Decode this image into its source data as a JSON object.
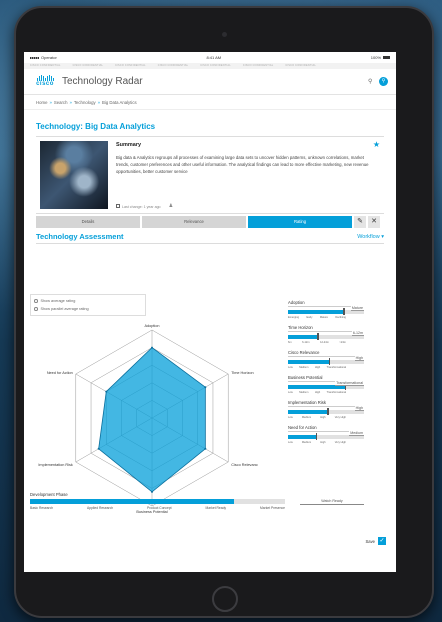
{
  "status": {
    "carrier": "Operator",
    "time": "8:41 AM",
    "battery": "100%"
  },
  "browser_tabs": [
    "CISCO CONFIDENTIAL",
    "CISCO CONFIDENTIAL",
    "CISCO CONFIDENTIAL",
    "CISCO CONFIDENTIAL",
    "CISCO CONFIDENTIAL",
    "CISCO CONFIDENTIAL",
    "CISCO CONFIDENTIAL"
  ],
  "header": {
    "logo": "cisco",
    "title": "Technology Radar"
  },
  "breadcrumb": [
    "Home",
    "Search",
    "Technology",
    "Big Data Analytics"
  ],
  "page": {
    "title": "Technology: Big Data Analytics"
  },
  "summary": {
    "title": "Summary",
    "text": "Big data & Analytics regroups all processes of examining large data sets to uncover hidden patterns, unknown correlations, market trends, customer preferences and other useful information. The analytical findings can lead to more effective marketing, new revenue opportunities, better customer service",
    "last_change": "Last change: 1 year ago"
  },
  "tabs": [
    {
      "label": "Details",
      "active": false
    },
    {
      "label": "Relevance",
      "active": false
    },
    {
      "label": "Rating",
      "active": true
    }
  ],
  "assessment": {
    "title": "Technology Assessment",
    "workflow": "Workflow",
    "options": [
      "Show average rating",
      "Show parallel average rating"
    ]
  },
  "chart_data": {
    "type": "radar",
    "axes": [
      "Adoption",
      "Time Horizon",
      "Cisco Relevance",
      "Business Potential",
      "Implementation Risk",
      "Need for Action"
    ],
    "max": 5,
    "values": [
      4,
      3.5,
      3.5,
      4.2,
      3.5,
      3
    ]
  },
  "sliders": [
    {
      "label": "Adoption",
      "value_label": "Mature",
      "fraction": 0.95,
      "ticks": [
        "Emerging",
        "Early",
        "Mature",
        "Declining"
      ]
    },
    {
      "label": "Time Horizon",
      "value_label": "6-12m",
      "fraction": 0.5,
      "ticks": [
        "6m",
        "6-12m",
        "12-24m",
        ">24m"
      ]
    },
    {
      "label": "Cisco Relevance",
      "value_label": "High",
      "fraction": 0.7,
      "ticks": [
        "Low",
        "Medium",
        "High",
        "Transformational"
      ]
    },
    {
      "label": "Business Potential",
      "value_label": "Transformational",
      "fraction": 0.98,
      "ticks": [
        "Low",
        "Medium",
        "High",
        "Transformational"
      ]
    },
    {
      "label": "Implementation Risk",
      "value_label": "High",
      "fraction": 0.68,
      "ticks": [
        "Low",
        "Medium",
        "High",
        "Very High"
      ]
    },
    {
      "label": "Need for Action",
      "value_label": "Medium",
      "fraction": 0.48,
      "ticks": [
        "Low",
        "Medium",
        "High",
        "Very High"
      ]
    }
  ],
  "development_phase": {
    "label": "Development Phase",
    "fraction": 0.8,
    "ticks": [
      "Basic Research",
      "Applied Research",
      "Product Concept",
      "Market Ready",
      "Market Presence"
    ],
    "watch": "Watch Ready"
  },
  "save": {
    "label": "Save"
  },
  "colors": {
    "accent": "#049fd9"
  }
}
